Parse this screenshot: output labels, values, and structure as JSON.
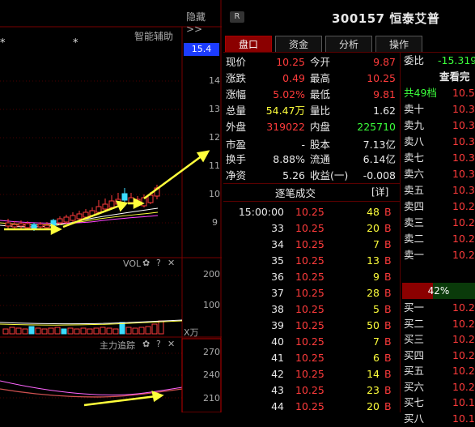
{
  "chart": {
    "hide_label": "隐藏>>",
    "indicator_label": "智能辅助",
    "price_tag": "15.4",
    "price_axis": [
      "14",
      "13",
      "12",
      "11",
      "10",
      "9"
    ],
    "asterisks": [
      "*",
      "*"
    ],
    "vol_label": "VOL",
    "vol_axis": [
      "200",
      "100"
    ],
    "vol_unit": "X万",
    "zl_label": "主力追踪",
    "zl_axis": [
      "270",
      "240",
      "210"
    ],
    "panel_icons": [
      "✿",
      "?",
      "✕"
    ]
  },
  "header": {
    "badge": "R",
    "stock_code": "300157",
    "stock_name": "恒泰艾普"
  },
  "tabs": [
    "盘口",
    "资金",
    "分析",
    "操作"
  ],
  "quote": {
    "rows": [
      {
        "l1": "现价",
        "v1": "10.25",
        "l2": "今开",
        "v2": "9.87",
        "c1": "red",
        "c2": "red"
      },
      {
        "l1": "涨跌",
        "v1": "0.49",
        "l2": "最高",
        "v2": "10.25",
        "c1": "red",
        "c2": "red"
      },
      {
        "l1": "涨幅",
        "v1": "5.02%",
        "l2": "最低",
        "v2": "9.81",
        "c1": "red",
        "c2": "red"
      },
      {
        "l1": "总量",
        "v1": "54.47万",
        "l2": "量比",
        "v2": "1.62",
        "c1": "yellow",
        "c2": "white"
      },
      {
        "l1": "外盘",
        "v1": "319022",
        "l2": "内盘",
        "v2": "225710",
        "c1": "red",
        "c2": "green"
      },
      {
        "l1": "市盈",
        "v1": "-",
        "l2": "股本",
        "v2": "7.13亿",
        "c1": "white",
        "c2": "white"
      },
      {
        "l1": "换手",
        "v1": "8.88%",
        "l2": "流通",
        "v2": "6.14亿",
        "c1": "white",
        "c2": "white"
      },
      {
        "l1": "净资",
        "v1": "5.26",
        "l2": "收益(一)",
        "v2": "-0.008",
        "c1": "white",
        "c2": "white"
      }
    ]
  },
  "trades": {
    "title": "逐笔成交",
    "detail": "[详]",
    "rows": [
      {
        "t": "15:00:00",
        "p": "10.25",
        "v": "48",
        "s": "B"
      },
      {
        "t": "33",
        "p": "10.25",
        "v": "20",
        "s": "B"
      },
      {
        "t": "34",
        "p": "10.25",
        "v": "7",
        "s": "B"
      },
      {
        "t": "35",
        "p": "10.25",
        "v": "13",
        "s": "B"
      },
      {
        "t": "36",
        "p": "10.25",
        "v": "9",
        "s": "B"
      },
      {
        "t": "37",
        "p": "10.25",
        "v": "28",
        "s": "B"
      },
      {
        "t": "38",
        "p": "10.25",
        "v": "5",
        "s": "B"
      },
      {
        "t": "39",
        "p": "10.25",
        "v": "50",
        "s": "B"
      },
      {
        "t": "40",
        "p": "10.25",
        "v": "7",
        "s": "B"
      },
      {
        "t": "41",
        "p": "10.25",
        "v": "6",
        "s": "B"
      },
      {
        "t": "42",
        "p": "10.25",
        "v": "14",
        "s": "B"
      },
      {
        "t": "43",
        "p": "10.25",
        "v": "23",
        "s": "B"
      },
      {
        "t": "44",
        "p": "10.25",
        "v": "20",
        "s": "B"
      }
    ]
  },
  "orderbook": {
    "weibi_label": "委比",
    "weibi_value": "-15.319",
    "view_all": "查看完",
    "total_label": "共49档",
    "total_value": "10.5",
    "sells": [
      {
        "l": "卖十",
        "p": "10.3"
      },
      {
        "l": "卖九",
        "p": "10.3"
      },
      {
        "l": "卖八",
        "p": "10.3"
      },
      {
        "l": "卖七",
        "p": "10.3"
      },
      {
        "l": "卖六",
        "p": "10.3"
      },
      {
        "l": "卖五",
        "p": "10.3"
      },
      {
        "l": "卖四",
        "p": "10.2"
      },
      {
        "l": "卖三",
        "p": "10.2"
      },
      {
        "l": "卖二",
        "p": "10.2"
      },
      {
        "l": "卖一",
        "p": "10.2"
      }
    ],
    "ratio": "42%",
    "ratio_fill": 0.42,
    "buys": [
      {
        "l": "买一",
        "p": "10.2"
      },
      {
        "l": "买二",
        "p": "10.2"
      },
      {
        "l": "买三",
        "p": "10.2"
      },
      {
        "l": "买四",
        "p": "10.2"
      },
      {
        "l": "买五",
        "p": "10.2"
      },
      {
        "l": "买六",
        "p": "10.2"
      },
      {
        "l": "买七",
        "p": "10.1"
      },
      {
        "l": "买八",
        "p": "10.1"
      }
    ]
  },
  "colors": {
    "up": "#ff3b3b",
    "down": "#3bff3b",
    "accent": "#8b0000",
    "price_tag_bg": "#1c3cff",
    "arrow": "#ffff3b"
  }
}
